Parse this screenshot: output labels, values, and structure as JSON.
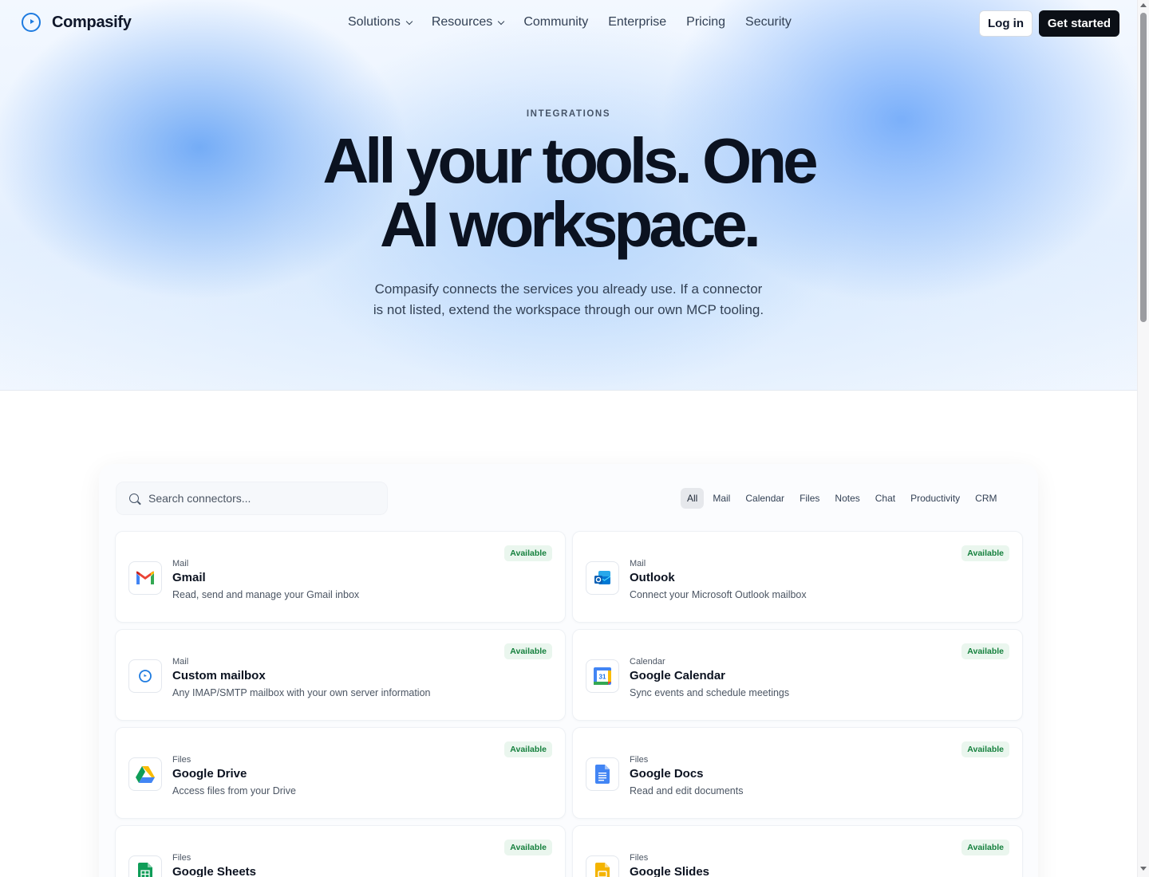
{
  "brand": {
    "name": "Compasify",
    "accent": "#1e7be0"
  },
  "nav": {
    "items": [
      {
        "label": "Solutions",
        "has_menu": true
      },
      {
        "label": "Resources",
        "has_menu": true
      },
      {
        "label": "Community",
        "has_menu": false
      },
      {
        "label": "Enterprise",
        "has_menu": false
      },
      {
        "label": "Pricing",
        "has_menu": false
      },
      {
        "label": "Security",
        "has_menu": false
      }
    ],
    "login_label": "Log in",
    "cta_label": "Get started"
  },
  "hero": {
    "eyebrow": "INTEGRATIONS",
    "headline_line1": "All your tools. One",
    "headline_line2": "AI workspace.",
    "subtitle_line1": "Compasify connects the services you already use. If a connector",
    "subtitle_line2": "is not listed, extend the workspace through our own MCP tooling."
  },
  "search": {
    "placeholder": "Search connectors...",
    "value": ""
  },
  "filters": {
    "selected": "All",
    "items": [
      "All",
      "Mail",
      "Calendar",
      "Files",
      "Notes",
      "Chat",
      "Productivity",
      "CRM"
    ]
  },
  "connectors": [
    {
      "category": "Mail",
      "name": "Gmail",
      "description": "Read, send and manage your Gmail inbox",
      "status": "Available",
      "icon": "gmail-icon"
    },
    {
      "category": "Mail",
      "name": "Outlook",
      "description": "Connect your Microsoft Outlook mailbox",
      "status": "Available",
      "icon": "outlook-icon"
    },
    {
      "category": "Mail",
      "name": "Custom mailbox",
      "description": "Any IMAP/SMTP mailbox with your own server information",
      "status": "Available",
      "icon": "compass-icon"
    },
    {
      "category": "Calendar",
      "name": "Google Calendar",
      "description": "Sync events and schedule meetings",
      "status": "Available",
      "icon": "google-calendar-icon"
    },
    {
      "category": "Files",
      "name": "Google Drive",
      "description": "Access files from your Drive",
      "status": "Available",
      "icon": "google-drive-icon"
    },
    {
      "category": "Files",
      "name": "Google Docs",
      "description": "Read and edit documents",
      "status": "Available",
      "icon": "google-docs-icon"
    },
    {
      "category": "Files",
      "name": "Google Sheets",
      "description": "",
      "status": "Available",
      "icon": "google-sheets-icon"
    },
    {
      "category": "Files",
      "name": "Google Slides",
      "description": "",
      "status": "Available",
      "icon": "google-slides-icon"
    }
  ],
  "colors": {
    "badge_text": "#15803d",
    "badge_bg": "#eaf6ee",
    "cta_bg": "#0b0f16"
  },
  "calendar_icon_day": "31"
}
